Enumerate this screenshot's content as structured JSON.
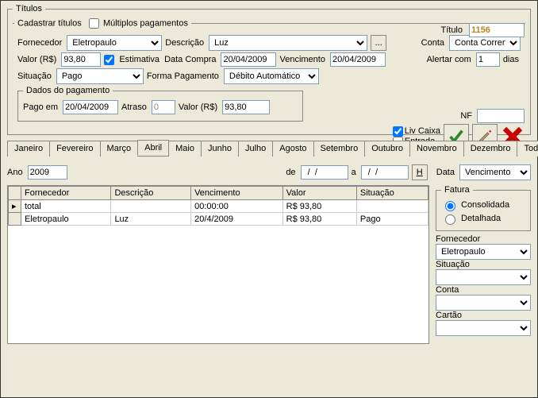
{
  "panel": {
    "title": "Títulos",
    "cadastrar_legend": "Cadastrar títulos",
    "multiplos_label": "Múltiplos pagamentos",
    "titulo_label": "Título",
    "titulo_value": "1156",
    "fornecedor_label": "Fornecedor",
    "fornecedor_value": "Eletropaulo",
    "descricao_label": "Descrição",
    "descricao_value": "Luz",
    "conta_label": "Conta",
    "conta_value": "Conta Corren",
    "valor_label": "Valor (R$)",
    "valor_value": "93,80",
    "estimativa_label": "Estimativa",
    "data_compra_label": "Data Compra",
    "data_compra_value": "20/04/2009",
    "vencimento_label": "Vencimento",
    "vencimento_value": "20/04/2009",
    "alertar_label": "Alertar com",
    "alertar_value": "1",
    "dias_label": "dias",
    "situacao_label": "Situação",
    "situacao_value": "Pago",
    "forma_pg_label": "Forma Pagamento",
    "forma_pg_value": "Débito Automático",
    "dados_pg_legend": "Dados do pagamento",
    "pago_em_label": "Pago em",
    "pago_em_value": "20/04/2009",
    "atraso_label": "Atraso",
    "atraso_value": "0",
    "pg_valor_label": "Valor (R$)",
    "pg_valor_value": "93,80",
    "nf_label": "NF",
    "nf_value": "",
    "liv_caixa_label": "Liv Caixa",
    "entrada_label": "Entrada"
  },
  "tabs": [
    "Janeiro",
    "Fevereiro",
    "Março",
    "Abril",
    "Maio",
    "Junho",
    "Julho",
    "Agosto",
    "Setembro",
    "Outubro",
    "Novembro",
    "Dezembro",
    "Todos"
  ],
  "tabs_active": "Abril",
  "filter": {
    "ano_label": "Ano",
    "ano_value": "2009",
    "de_label": "de",
    "de_value": "  /  /",
    "a_label": "a",
    "a_value": "  /  /",
    "h_label": "H",
    "data_label": "Data",
    "data_value": "Vencimento"
  },
  "grid": {
    "headers": [
      "Fornecedor",
      "Descrição",
      "Vencimento",
      "Valor",
      "Situação"
    ],
    "rows": [
      {
        "fornecedor": "total",
        "descricao": "",
        "vencimento": "00:00:00",
        "valor": "R$ 93,80",
        "situacao": ""
      },
      {
        "fornecedor": "Eletropaulo",
        "descricao": "Luz",
        "vencimento": "20/4/2009",
        "valor": "R$ 93,80",
        "situacao": "Pago"
      }
    ]
  },
  "side": {
    "fatura_legend": "Fatura",
    "fatura_consolidada": "Consolidada",
    "fatura_detalhada": "Detalhada",
    "fornecedor_label": "Fornecedor",
    "fornecedor_value": "Eletropaulo",
    "situacao_label": "Situação",
    "conta_label": "Conta",
    "cartao_label": "Cartão"
  }
}
